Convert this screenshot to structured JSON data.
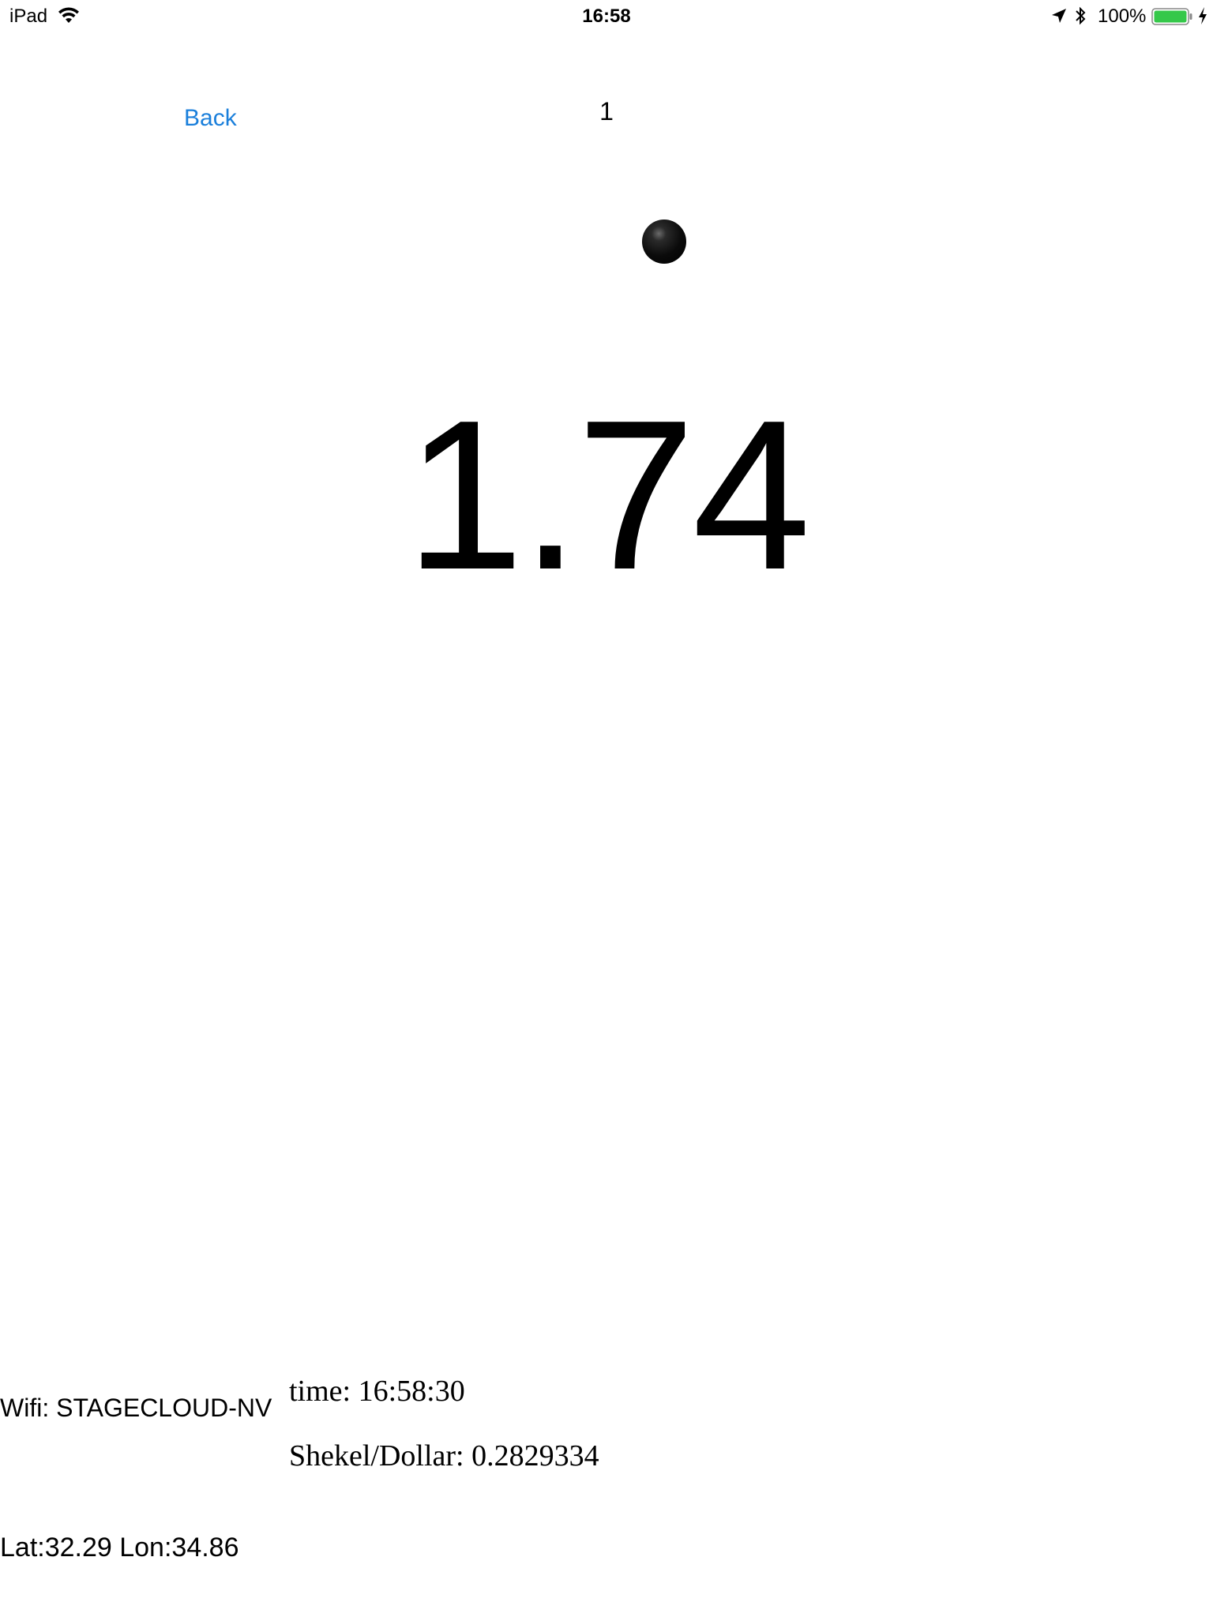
{
  "status_bar": {
    "device": "iPad",
    "time": "16:58",
    "battery_percent": "100%",
    "battery_color": "#35c84a",
    "icons": [
      "wifi-icon",
      "location-arrow-icon",
      "bluetooth-icon",
      "battery-icon",
      "charging-bolt-icon"
    ]
  },
  "nav": {
    "back_label": "Back",
    "title": "1",
    "accent_color": "#1a7fdb"
  },
  "main": {
    "value": "1.74"
  },
  "info": {
    "wifi": "Wifi: STAGECLOUD-NV",
    "time": "time: 16:58:30",
    "rate": "Shekel/Dollar: 0.2829334",
    "coords": "Lat:32.29 Lon:34.86"
  }
}
